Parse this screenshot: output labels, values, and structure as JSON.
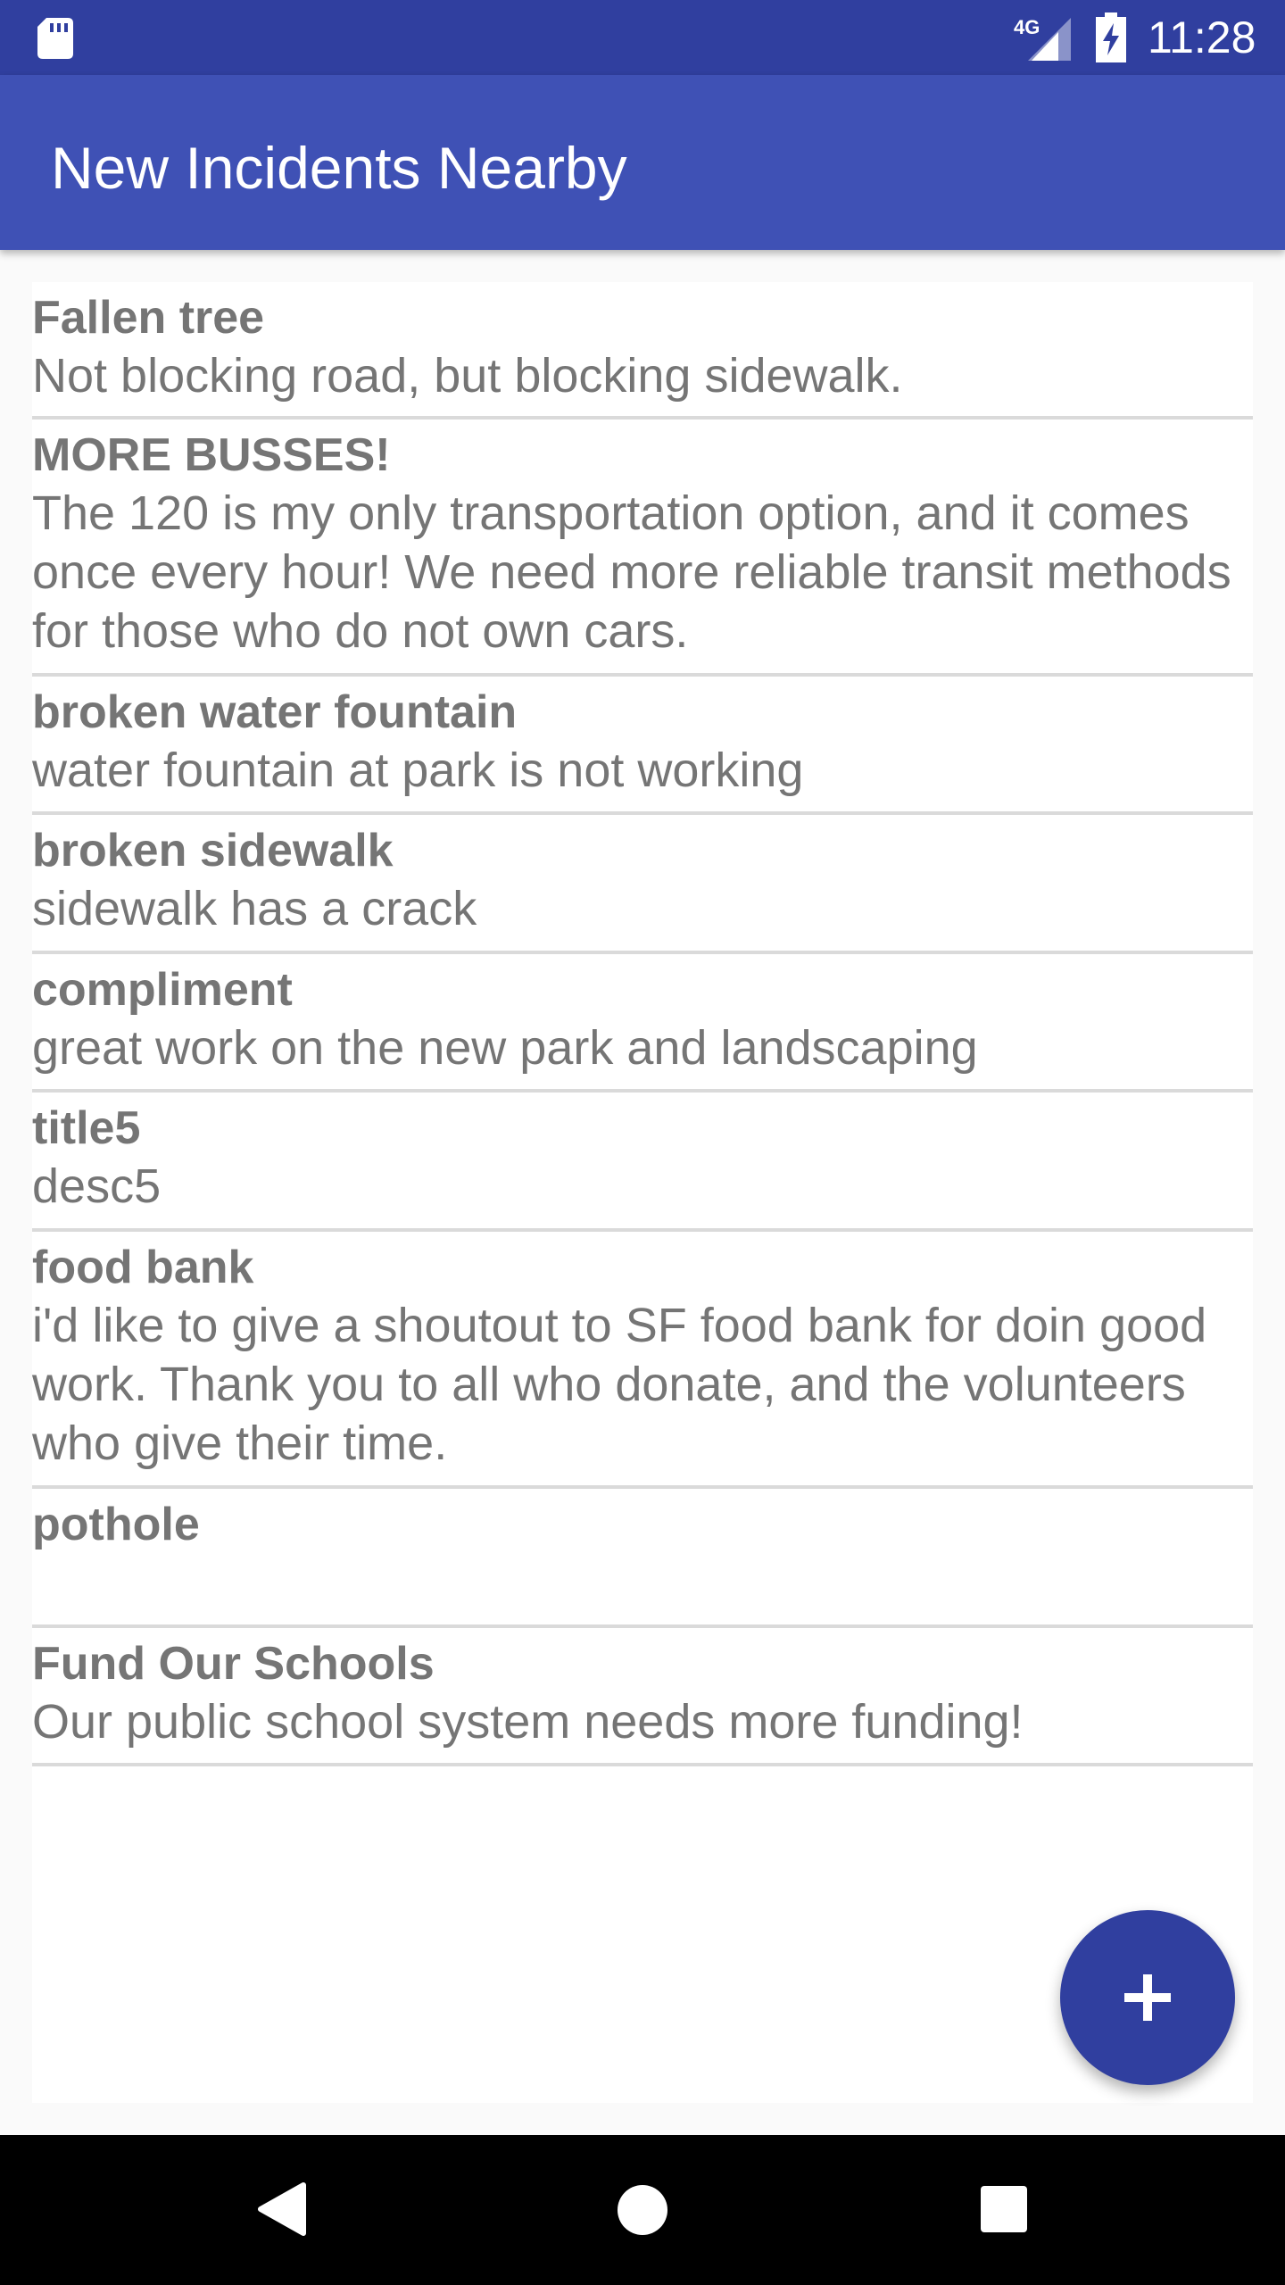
{
  "status_bar": {
    "network": "4G",
    "time": "11:28"
  },
  "app_bar": {
    "title": "New Incidents Nearby"
  },
  "incidents": [
    {
      "title": "Fallen tree",
      "description": "Not blocking road, but blocking sidewalk."
    },
    {
      "title": "MORE BUSSES!",
      "description": "The 120 is my only transportation option, and it comes once every hour! We need more reliable transit methods for those who do not own cars."
    },
    {
      "title": "broken water fountain",
      "description": "water fountain at park is not working"
    },
    {
      "title": "broken sidewalk",
      "description": "sidewalk has a crack"
    },
    {
      "title": "compliment",
      "description": "great work on the new park and landscaping"
    },
    {
      "title": "title5",
      "description": "desc5"
    },
    {
      "title": "food bank",
      "description": "i'd like to give a shoutout to SF food bank for doin good work. Thank you to all who donate, and the volunteers who give their time."
    },
    {
      "title": "pothole",
      "description": ""
    },
    {
      "title": "Fund Our Schools",
      "description": "Our public school system needs more funding!"
    }
  ],
  "fab": {
    "icon": "plus-icon"
  },
  "nav_bar": {
    "back_icon": "back-icon",
    "home_icon": "home-icon",
    "recents_icon": "recents-icon"
  },
  "colors": {
    "status_bar": "#303f9f",
    "app_bar": "#3f51b5",
    "fab": "#303f9f",
    "list_text": "#757575",
    "divider": "#dadada"
  }
}
